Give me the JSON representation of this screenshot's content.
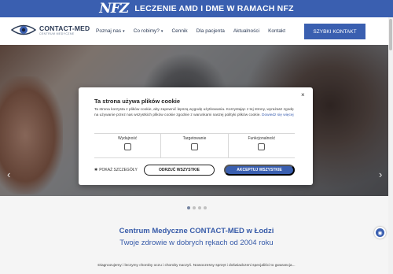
{
  "banner": {
    "logo_text": "NFZ",
    "text": "LECZENIE AMD I DME W RAMACH NFZ"
  },
  "header": {
    "logo_name": "CONTACT-MED",
    "logo_sub": "CENTRUM MEDYCZNE",
    "nav": [
      {
        "label": "Poznaj nas",
        "has_dropdown": true
      },
      {
        "label": "Co robimy?",
        "has_dropdown": true
      },
      {
        "label": "Cennik",
        "has_dropdown": false
      },
      {
        "label": "Dla pacjenta",
        "has_dropdown": false
      },
      {
        "label": "Aktualności",
        "has_dropdown": false
      },
      {
        "label": "Kontakt",
        "has_dropdown": false
      }
    ],
    "cta_label": "SZYBKI KONTAKT"
  },
  "hero": {
    "prev_icon": "‹",
    "next_icon": "›",
    "slide_count": 4,
    "active_slide": 1
  },
  "section": {
    "title": "Centrum Medyczne CONTACT-MED w Łodzi",
    "subtitle": "Twoje zdrowie w dobrych rękach od 2004 roku",
    "description": "Diagnozujemy i leczymy choroby oczu i choroby naczyń. Nowoczesny sprzęt i doświadczeni specjaliści to gwarancja..."
  },
  "cookie_modal": {
    "close_icon": "×",
    "title": "Ta strona używa plików cookie",
    "text": "Ta strona korzysta z plików cookie, aby zapewnić lepszą wygodę użytkowania. Korzystając z tej strony, wyrażasz zgodę na używanie przez nas wszystkich plików cookie zgodnie z warunkami naszej polityki plików cookie.",
    "link": "Dowiedz się więcej",
    "categories": [
      {
        "label": "Wydajność",
        "checked": false
      },
      {
        "label": "Targetowanie",
        "checked": false
      },
      {
        "label": "Funkcjonalność",
        "checked": false
      }
    ],
    "details_label": "POKAŻ SZCZEGÓŁY",
    "reject_label": "ODRZUĆ WSZYSTKIE",
    "accept_label": "AKCEPTUJ WSZYSTKIE"
  },
  "colors": {
    "brand_blue": "#3a5fb0",
    "title_dark": "#2b3a55"
  }
}
